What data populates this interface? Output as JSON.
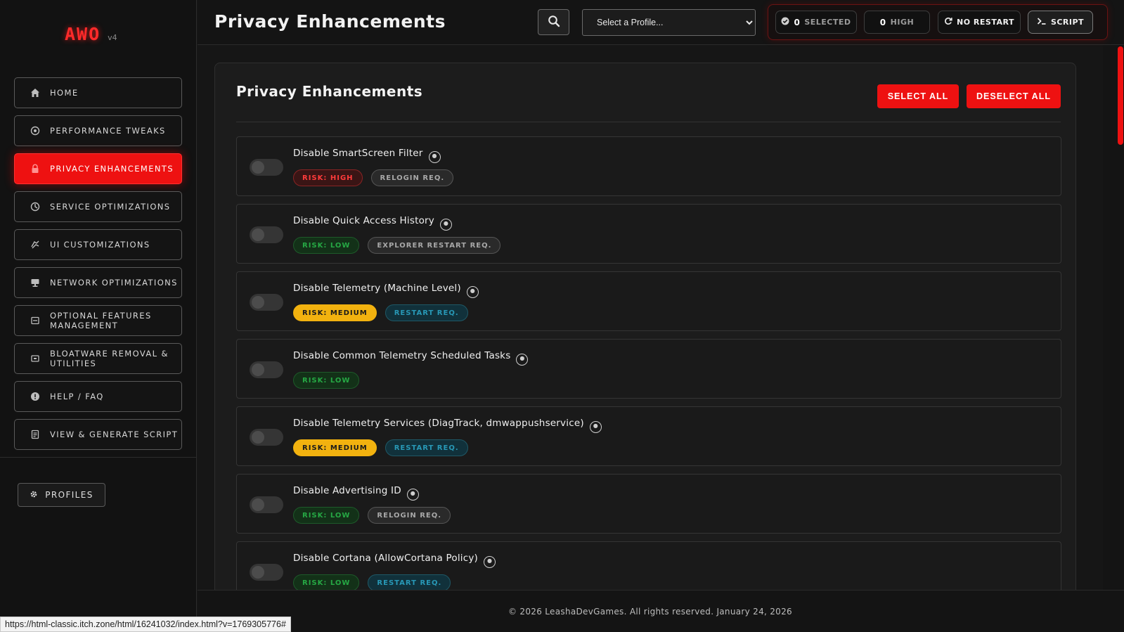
{
  "logo": {
    "text": "AWO",
    "version": "v4"
  },
  "sidebar": {
    "items": [
      {
        "label": "HOME",
        "icon": "home-icon"
      },
      {
        "label": "PERFORMANCE TWEAKS",
        "icon": "gauge-icon"
      },
      {
        "label": "PRIVACY ENHANCEMENTS",
        "icon": "lock-icon",
        "active": true
      },
      {
        "label": "SERVICE OPTIMIZATIONS",
        "icon": "cog-icon"
      },
      {
        "label": "UI CUSTOMIZATIONS",
        "icon": "paint-icon"
      },
      {
        "label": "NETWORK OPTIMIZATIONS",
        "icon": "network-icon"
      },
      {
        "label": "OPTIONAL FEATURES MANAGEMENT",
        "icon": "features-icon"
      },
      {
        "label": "BLOATWARE REMOVAL & UTILITIES",
        "icon": "bloatware-icon"
      },
      {
        "label": "HELP / FAQ",
        "icon": "help-icon"
      },
      {
        "label": "VIEW & GENERATE SCRIPT",
        "icon": "script-file-icon"
      }
    ],
    "profiles_label": "PROFILES"
  },
  "header": {
    "title": "Privacy Enhancements",
    "profile_select": {
      "value": "Select a Profile..."
    },
    "status": {
      "selected_count": "0",
      "selected_label": "SELECTED",
      "high_count": "0",
      "high_label": "HIGH",
      "restart_label": "NO RESTART",
      "script_label": "SCRIPT"
    }
  },
  "main": {
    "title": "Privacy Enhancements",
    "select_all": "SELECT ALL",
    "deselect_all": "DESELECT ALL",
    "tweaks": [
      {
        "name": "Disable SmartScreen Filter",
        "risk": "RISK: HIGH",
        "risk_level": "high",
        "req": "RELOGIN REQ.",
        "req_type": "relogin",
        "enabled": false
      },
      {
        "name": "Disable Quick Access History",
        "risk": "RISK: LOW",
        "risk_level": "low",
        "req": "EXPLORER RESTART REQ.",
        "req_type": "relogin",
        "enabled": false
      },
      {
        "name": "Disable Telemetry (Machine Level)",
        "risk": "RISK: MEDIUM",
        "risk_level": "medium",
        "req": "RESTART REQ.",
        "req_type": "restart",
        "enabled": false
      },
      {
        "name": "Disable Common Telemetry Scheduled Tasks",
        "risk": "RISK: LOW",
        "risk_level": "low",
        "req": "",
        "req_type": "",
        "enabled": false
      },
      {
        "name": "Disable Telemetry Services (DiagTrack, dmwappushservice)",
        "risk": "RISK: MEDIUM",
        "risk_level": "medium",
        "req": "RESTART REQ.",
        "req_type": "restart",
        "enabled": false
      },
      {
        "name": "Disable Advertising ID",
        "risk": "RISK: LOW",
        "risk_level": "low",
        "req": "RELOGIN REQ.",
        "req_type": "relogin",
        "enabled": false
      },
      {
        "name": "Disable Cortana (AllowCortana Policy)",
        "risk": "RISK: LOW",
        "risk_level": "low",
        "req": "RESTART REQ.",
        "req_type": "restart",
        "enabled": false
      }
    ]
  },
  "footer": {
    "text": "© 2026 LeashaDevGames. All rights reserved. January 24, 2026"
  },
  "status_bar": {
    "url": "https://html-classic.itch.zone/html/16241032/index.html?v=1769305776#"
  },
  "colors": {
    "accent": "#ee1111",
    "risk_high": "#ff3b3b",
    "risk_low": "#26a844",
    "risk_medium": "#f2b20f",
    "restart": "#2898b6"
  }
}
